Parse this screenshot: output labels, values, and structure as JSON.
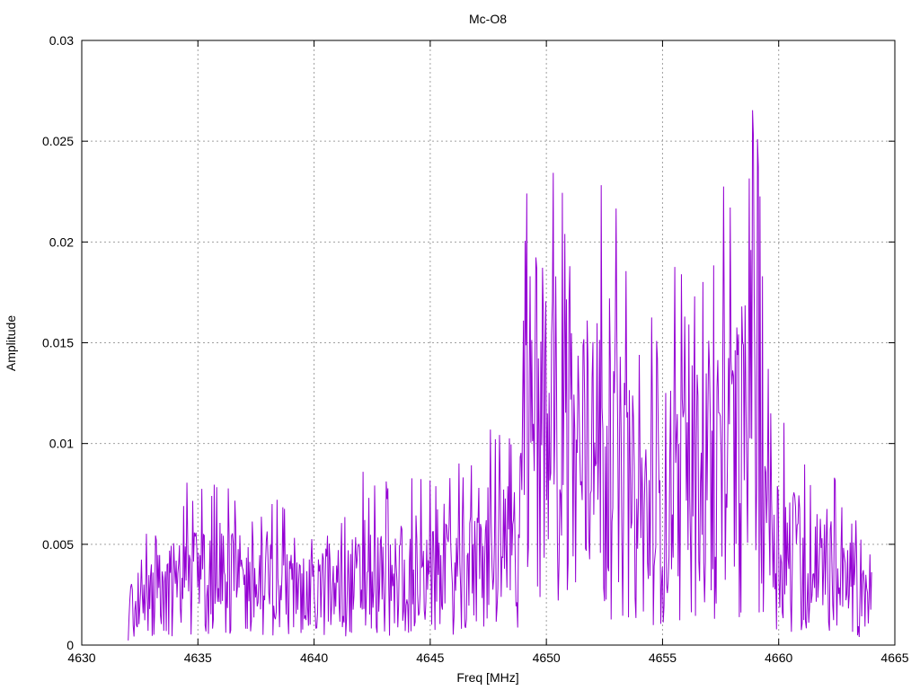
{
  "chart_data": {
    "type": "line",
    "title": "Mc-O8",
    "xlabel": "Freq [MHz]",
    "ylabel": "Amplitude",
    "xlim": [
      4630,
      4665
    ],
    "ylim": [
      0,
      0.03
    ],
    "x_ticks": [
      4630,
      4635,
      4640,
      4645,
      4650,
      4655,
      4660,
      4665
    ],
    "x_tick_labels": [
      "4630",
      "4635",
      "4640",
      "4645",
      "4650",
      "4655",
      "4660",
      "4665"
    ],
    "y_ticks": [
      0,
      0.005,
      0.01,
      0.015,
      0.02,
      0.025,
      0.03
    ],
    "y_tick_labels": [
      "0",
      "0.005",
      "0.01",
      "0.015",
      "0.02",
      "0.025",
      "0.03"
    ],
    "grid": true,
    "series_color": "#9400d3",
    "series": [
      {
        "x_start": 4632.0,
        "x_end": 4664.0,
        "sample_count": 900,
        "envelope": [
          {
            "x": 4632.0,
            "y": 0.0015
          },
          {
            "x": 4633.0,
            "y": 0.0025
          },
          {
            "x": 4635.0,
            "y": 0.003
          },
          {
            "x": 4638.0,
            "y": 0.0028
          },
          {
            "x": 4640.0,
            "y": 0.0022
          },
          {
            "x": 4642.0,
            "y": 0.003
          },
          {
            "x": 4645.0,
            "y": 0.003
          },
          {
            "x": 4647.0,
            "y": 0.0035
          },
          {
            "x": 4648.8,
            "y": 0.0045
          },
          {
            "x": 4649.2,
            "y": 0.009
          },
          {
            "x": 4651.0,
            "y": 0.0095
          },
          {
            "x": 4653.0,
            "y": 0.008
          },
          {
            "x": 4654.0,
            "y": 0.006
          },
          {
            "x": 4655.5,
            "y": 0.007
          },
          {
            "x": 4657.0,
            "y": 0.0075
          },
          {
            "x": 4658.5,
            "y": 0.009
          },
          {
            "x": 4659.2,
            "y": 0.01
          },
          {
            "x": 4660.0,
            "y": 0.0045
          },
          {
            "x": 4662.0,
            "y": 0.0035
          },
          {
            "x": 4664.0,
            "y": 0.002
          }
        ],
        "peaks": [
          {
            "x": 4634.4,
            "y": 0.0069
          },
          {
            "x": 4635.6,
            "y": 0.0074
          },
          {
            "x": 4638.2,
            "y": 0.007
          },
          {
            "x": 4642.1,
            "y": 0.0086
          },
          {
            "x": 4647.1,
            "y": 0.0078
          },
          {
            "x": 4649.3,
            "y": 0.0183
          },
          {
            "x": 4649.6,
            "y": 0.0187
          },
          {
            "x": 4650.8,
            "y": 0.0204
          },
          {
            "x": 4651.0,
            "y": 0.0188
          },
          {
            "x": 4652.7,
            "y": 0.0172
          },
          {
            "x": 4655.8,
            "y": 0.0184
          },
          {
            "x": 4656.4,
            "y": 0.0173
          },
          {
            "x": 4658.4,
            "y": 0.0168
          },
          {
            "x": 4658.9,
            "y": 0.0253
          },
          {
            "x": 4659.1,
            "y": 0.0251
          },
          {
            "x": 4658.8,
            "y": 0.0196
          },
          {
            "x": 4659.3,
            "y": 0.0183
          },
          {
            "x": 4662.4,
            "y": 0.0083
          }
        ]
      }
    ]
  }
}
